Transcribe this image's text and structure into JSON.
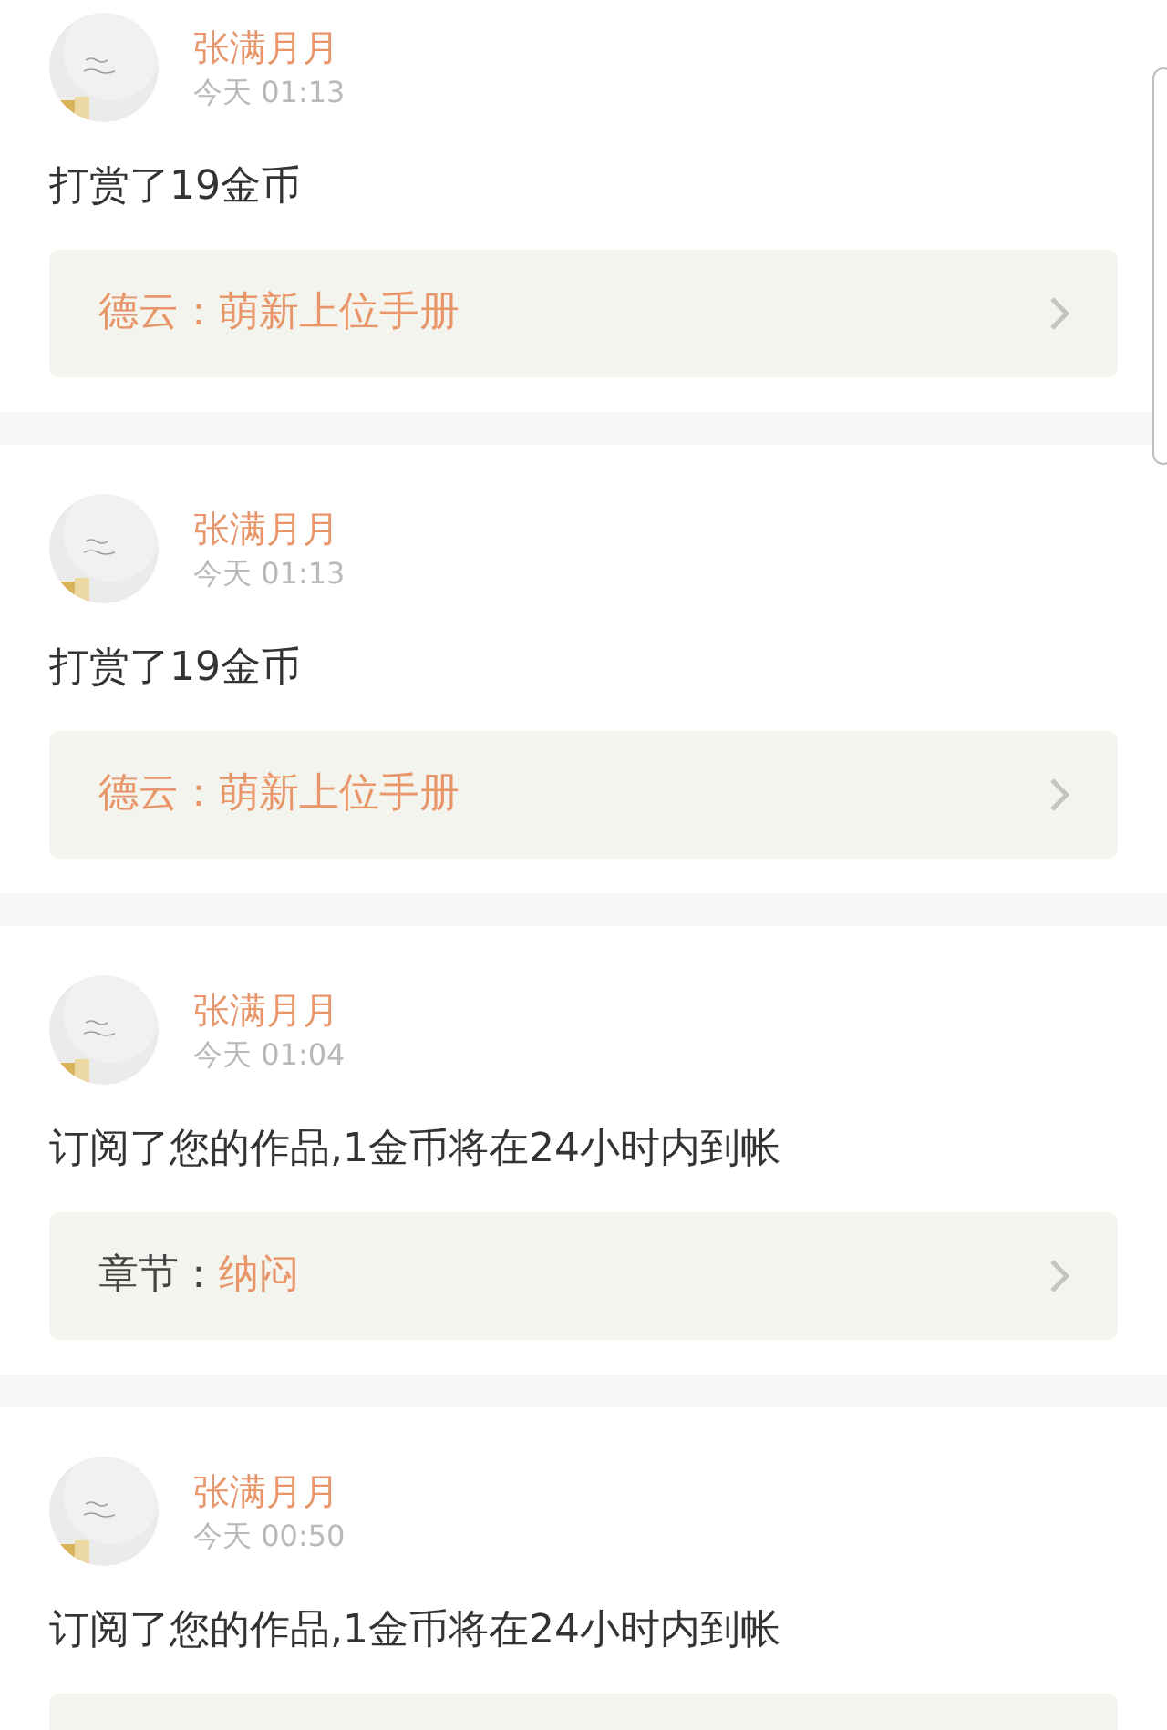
{
  "feed": [
    {
      "user": "张满月月",
      "time": "今天 01:13",
      "action": "打赏了19金币",
      "link": {
        "kind": "book",
        "label": "德云：",
        "title": "萌新上位手册"
      }
    },
    {
      "user": "张满月月",
      "time": "今天 01:13",
      "action": "打赏了19金币",
      "link": {
        "kind": "book",
        "label": "德云：",
        "title": "萌新上位手册"
      }
    },
    {
      "user": "张满月月",
      "time": "今天 01:04",
      "action": "订阅了您的作品,1金币将在24小时内到帐",
      "link": {
        "kind": "chapter",
        "label": "章节：",
        "title": "纳闷"
      }
    },
    {
      "user": "张满月月",
      "time": "今天 00:50",
      "action": "订阅了您的作品,1金币将在24小时内到帐",
      "link": {
        "kind": "cut"
      }
    }
  ]
}
